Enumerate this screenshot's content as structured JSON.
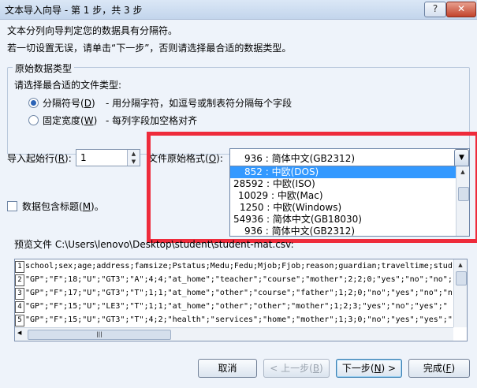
{
  "window": {
    "title": "文本导入向导 - 第 1 步，共 3 步",
    "help": "?",
    "close": "✕"
  },
  "intro": {
    "line1": "文本分列向导判定您的数据具有分隔符。",
    "line2": "若一切设置无误，请单击“下一步”，否则请选择最合适的数据类型。"
  },
  "group": {
    "legend": "原始数据类型",
    "prompt": "请选择最合适的文件类型:",
    "options": [
      {
        "label": "分隔符号(",
        "key": "D",
        "tail": ")",
        "desc": "- 用分隔字符，如逗号或制表符分隔每个字段",
        "selected": true
      },
      {
        "label": "固定宽度(",
        "key": "W",
        "tail": ")",
        "desc": "- 每列字段加空格对齐",
        "selected": false
      }
    ]
  },
  "start_row": {
    "label_pre": "导入起始行(",
    "key": "R",
    "label_post": "):",
    "value": "1"
  },
  "origin": {
    "label_pre": "文件原始格式(",
    "key": "O",
    "label_post": "):",
    "selected": "936 : 简体中文(GB2312)",
    "options": [
      "852 : 中欧(DOS)",
      "28592 : 中欧(ISO)",
      "10029 : 中欧(Mac)",
      "1250 : 中欧(Windows)",
      "54936 : 简体中文(GB18030)",
      "936 : 简体中文(GB2312)"
    ],
    "highlighted_index": 0
  },
  "header_check": {
    "label_pre": "数据包含标题(",
    "key": "M",
    "label_post": ")。",
    "checked": false
  },
  "preview": {
    "label": "预览文件 C:\\Users\\lenovo\\Desktop\\student\\student-mat.csv:",
    "rows": [
      {
        "num": "1",
        "text": "school;sex;age;address;famsize;Pstatus;Medu;Fedu;Mjob;Fjob;reason;guardian;traveltime;stud"
      },
      {
        "num": "2",
        "text": "\"GP\";\"F\";18;\"U\";\"GT3\";\"A\";4;4;\"at_home\";\"teacher\";\"course\";\"mother\";2;2;0;\"yes\";\"no\";\"no\";"
      },
      {
        "num": "3",
        "text": "\"GP\";\"F\";17;\"U\";\"GT3\";\"T\";1;1;\"at_home\";\"other\";\"course\";\"father\";1;2;0;\"no\";\"yes\";\"no\";\"n"
      },
      {
        "num": "4",
        "text": "\"GP\";\"F\";15;\"U\";\"LE3\";\"T\";1;1;\"at_home\";\"other\";\"other\";\"mother\";1;2;3;\"yes\";\"no\";\"yes\";\""
      },
      {
        "num": "5",
        "text": "\"GP\";\"F\";15;\"U\";\"GT3\";\"T\";4;2;\"health\";\"services\";\"home\";\"mother\";1;3;0;\"no\";\"yes\";\"yes\";\""
      }
    ]
  },
  "buttons": {
    "cancel": "取消",
    "back_pre": "< 上一步(",
    "back_key": "B",
    "back_post": ")",
    "next_pre": "下一步(",
    "next_key": "N",
    "next_post": ") >",
    "finish_pre": "完成(",
    "finish_key": "F",
    "finish_post": ")"
  }
}
